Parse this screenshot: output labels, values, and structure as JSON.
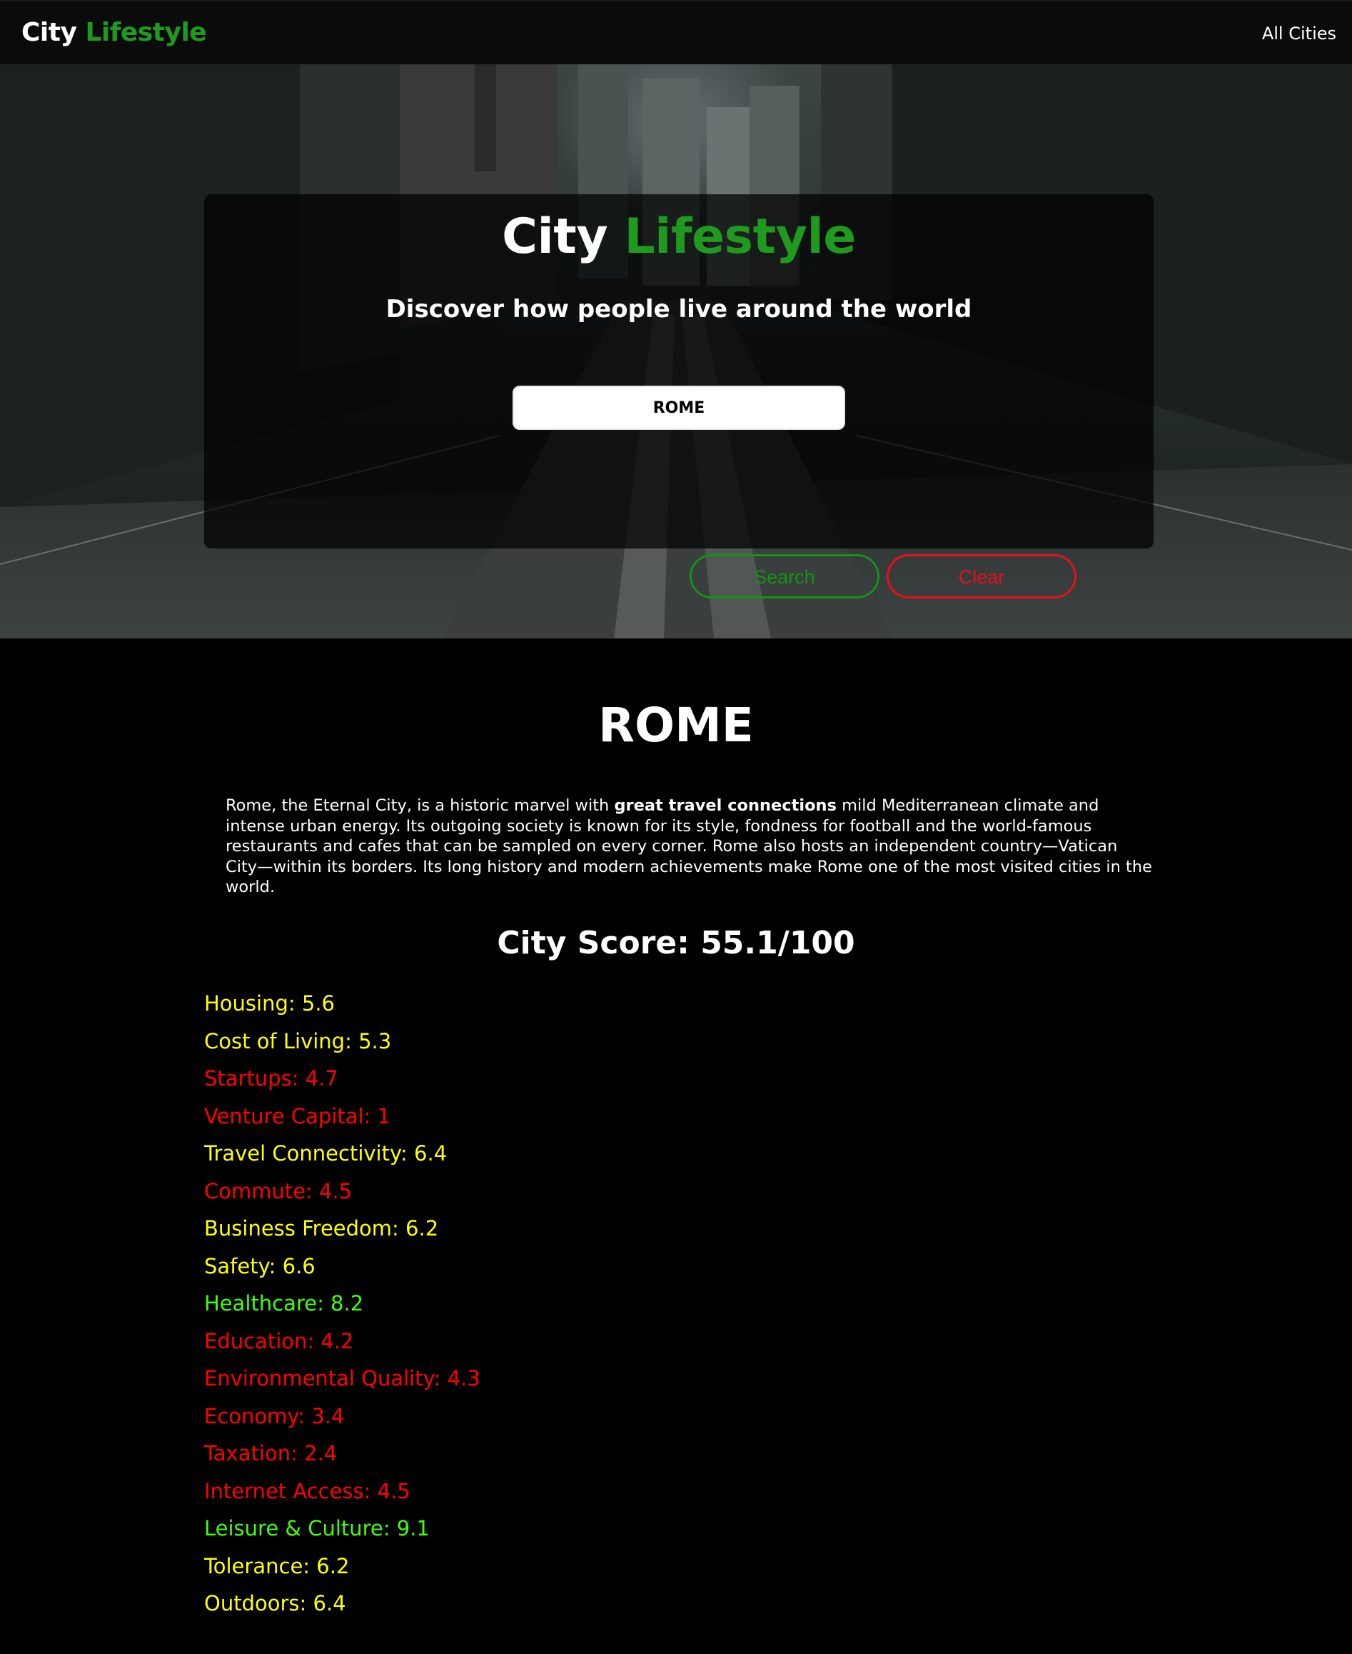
{
  "navbar": {
    "brand_part1": "City",
    "brand_part2": "Lifestyle",
    "all_cities_label": "All Cities"
  },
  "hero": {
    "title_part1": "City",
    "title_part2": "Lifestyle",
    "subtitle": "Discover how people live around the world",
    "search": {
      "value": "ROME",
      "placeholder": ""
    },
    "search_button_label": "Search",
    "clear_button_label": "Clear"
  },
  "city": {
    "name": "ROME",
    "description": {
      "before_bold": "Rome, the Eternal City, is a historic marvel with ",
      "bold": "great travel connections",
      "after_bold": " mild Mediterranean climate and intense urban energy. Its outgoing society is known for its style, fondness for football and the world-famous restaurants and cafes that can be sampled on every corner. Rome also hosts an independent country—Vatican City—within its borders. Its long history and modern achievements make Rome one of the most visited cities in the world."
    },
    "score_text": "City Score: 55.1/100",
    "categories": [
      {
        "label": "Housing: 5.6",
        "color": "#ffff00"
      },
      {
        "label": "Cost of Living: 5.3",
        "color": "#ffff00"
      },
      {
        "label": "Startups: 4.7",
        "color": "#ff0000"
      },
      {
        "label": "Venture Capital: 1",
        "color": "#ff0000"
      },
      {
        "label": "Travel Connectivity: 6.4",
        "color": "#ffff00"
      },
      {
        "label": "Commute: 4.5",
        "color": "#ff0000"
      },
      {
        "label": "Business Freedom: 6.2",
        "color": "#ffff00"
      },
      {
        "label": "Safety: 6.6",
        "color": "#ffff00"
      },
      {
        "label": "Healthcare: 8.2",
        "color": "#40ff00"
      },
      {
        "label": "Education: 4.2",
        "color": "#ff0000"
      },
      {
        "label": "Environmental Quality: 4.3",
        "color": "#ff0000"
      },
      {
        "label": "Economy: 3.4",
        "color": "#ff0000"
      },
      {
        "label": "Taxation: 2.4",
        "color": "#ff0000"
      },
      {
        "label": "Internet Access: 4.5",
        "color": "#ff0000"
      },
      {
        "label": "Leisure & Culture: 9.1",
        "color": "#40ff00"
      },
      {
        "label": "Tolerance: 6.2",
        "color": "#ffff00"
      },
      {
        "label": "Outdoors: 6.4",
        "color": "#ffff00"
      }
    ]
  },
  "colors": {
    "brand_green": "#1f9a1f",
    "search_green": "#159315",
    "clear_red": "#e8101a",
    "background": "#000000"
  }
}
